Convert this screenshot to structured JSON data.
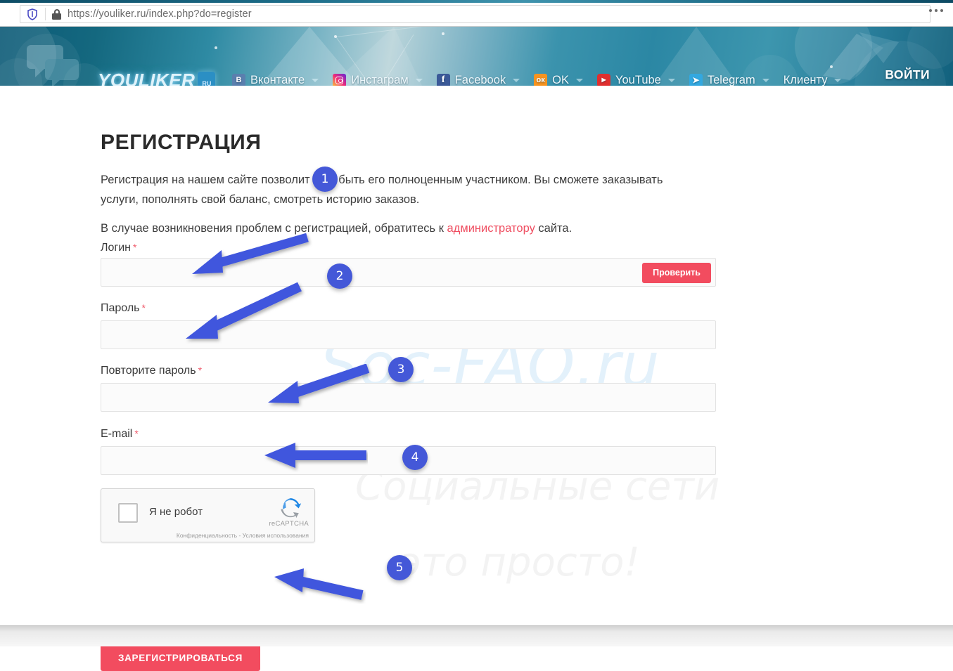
{
  "browser": {
    "url": "https://youliker.ru/index.php?do=register",
    "shield_icon": "shield-icon",
    "lock_icon": "lock-icon",
    "menu_icon": "more-options-icon"
  },
  "header": {
    "logo_text": "YOULIKER",
    "logo_suffix": "RU",
    "nav_items": [
      {
        "label": "Вконтакте",
        "icon": "vk-icon",
        "icon_glyph": "B"
      },
      {
        "label": "Инстаграм",
        "icon": "instagram-icon",
        "icon_glyph": ""
      },
      {
        "label": "Facebook",
        "icon": "facebook-icon",
        "icon_glyph": "f"
      },
      {
        "label": "OK",
        "icon": "odnoklassniki-icon",
        "icon_glyph": "ок"
      },
      {
        "label": "YouTube",
        "icon": "youtube-icon",
        "icon_glyph": "▶"
      },
      {
        "label": "Telegram",
        "icon": "telegram-icon",
        "icon_glyph": "➤"
      },
      {
        "label": "Клиенту",
        "icon": "",
        "icon_glyph": ""
      }
    ],
    "login_label": "ВОЙТИ"
  },
  "watermark": {
    "main": "Soc-FAQ.ru",
    "line1": "Социальные сети",
    "line2": "это просто!"
  },
  "main": {
    "title": "РЕГИСТРАЦИЯ",
    "intro_paragraph_1": "Регистрация на нашем сайте позволит Вам быть его полноценным участником. Вы сможете заказывать услуги, пополнять свой баланс, смотреть историю заказов.",
    "intro_paragraph_2_before": "В случае возникновения проблем с регистрацией, обратитесь к ",
    "intro_paragraph_2_link": "администратору",
    "intro_paragraph_2_after": " сайта.",
    "fields": [
      {
        "label": "Логин",
        "required": "*",
        "value": "",
        "placeholder": ""
      },
      {
        "label": "Пароль",
        "required": "*",
        "value": "",
        "placeholder": ""
      },
      {
        "label": "Повторите пароль",
        "required": "*",
        "value": "",
        "placeholder": ""
      },
      {
        "label": "E-mail",
        "required": "*",
        "value": "",
        "placeholder": ""
      }
    ],
    "check_button_label": "Проверить",
    "submit_button_label": "ЗАРЕГИСТРИРОВАТЬСЯ"
  },
  "recaptcha": {
    "checkbox_label": "Я не робот",
    "brand": "reCAPTCHA",
    "terms": "Конфиденциальность - Условия использования",
    "checked": false
  },
  "annotations": [
    {
      "number": "1"
    },
    {
      "number": "2"
    },
    {
      "number": "3"
    },
    {
      "number": "4"
    },
    {
      "number": "5"
    }
  ],
  "colors": {
    "accent_red": "#f24c5f",
    "link_red": "#ef4d60",
    "annotation_blue": "#4458d8",
    "header_teal": "#2e8aa3"
  }
}
